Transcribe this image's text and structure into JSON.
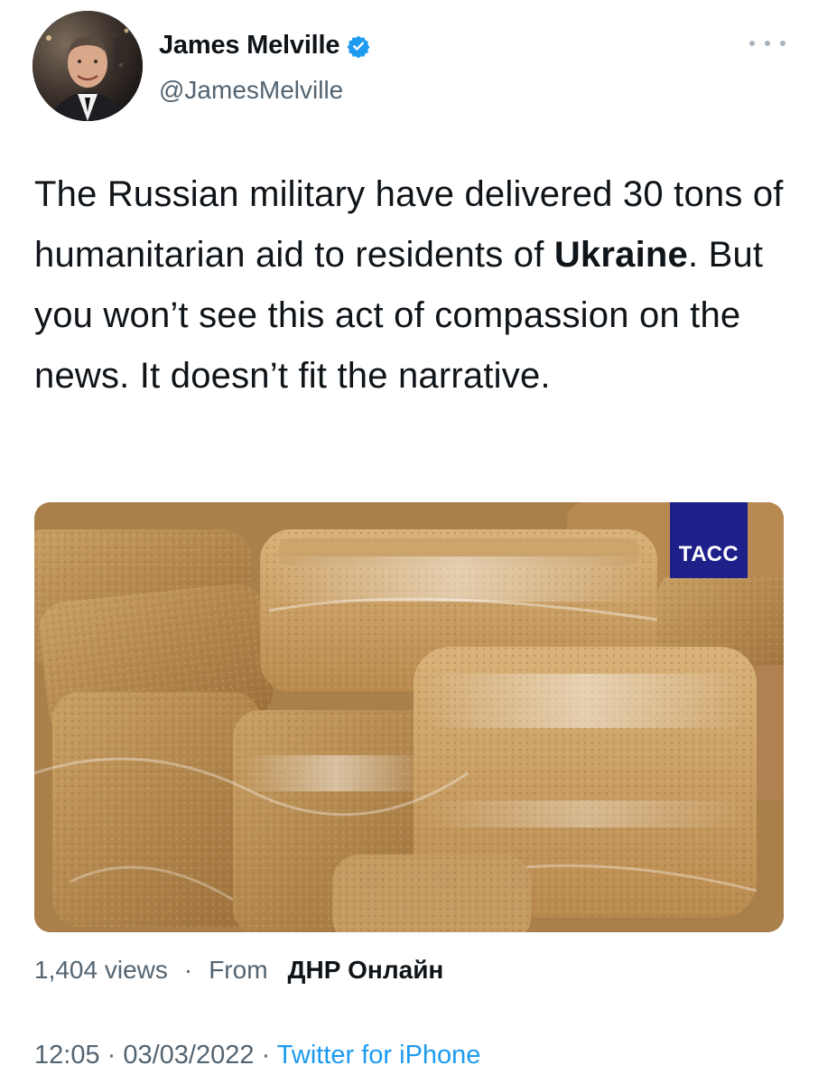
{
  "author": {
    "display_name": "James Melville",
    "handle": "@JamesMelville",
    "verified": true
  },
  "tweet": {
    "text_1": "The Russian military have delivered 30 tons of humanitarian aid to residents of ",
    "text_bold": "Ukraine",
    "text_2": ". But you won’t see this act of compassion on the news. It doesn’t fit the narrative."
  },
  "media": {
    "watermark": "ТАСС",
    "subject": "loaves of bread in plastic wrap"
  },
  "stats": {
    "views": "1,404 views",
    "separator": "·",
    "from_label": "From",
    "source": "ДНР Онлайн"
  },
  "timestamp": {
    "time": "12:05",
    "separator": " · ",
    "date": "03/03/2022",
    "client": "Twitter for iPhone"
  },
  "colors": {
    "link": "#1d9bf0",
    "verified_badge": "#1d9bf0",
    "secondary_text": "#536471",
    "tass_blue": "#1f1f8a"
  },
  "icons": {
    "verified": "verified-badge-icon",
    "more": "more-options-icon"
  }
}
